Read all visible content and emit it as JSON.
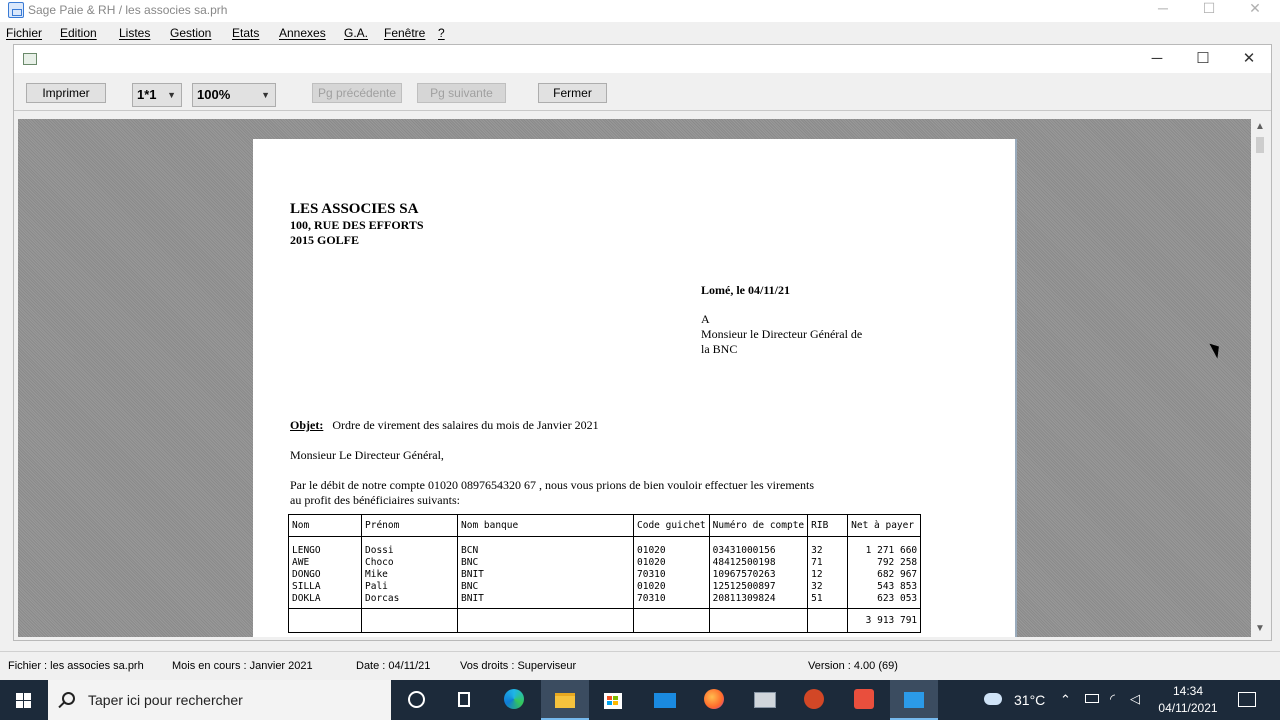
{
  "window": {
    "title": "Sage Paie & RH / les associes sa.prh"
  },
  "menu": [
    "Fichier",
    "Edition",
    "Listes",
    "Gestion",
    "Etats",
    "Annexes",
    "G.A.",
    "Fenêtre",
    "?"
  ],
  "toolbar": {
    "print": "Imprimer",
    "page_layout": "1*1",
    "zoom": "100%",
    "prev_page": "Pg précédente",
    "next_page": "Pg suivante",
    "close": "Fermer"
  },
  "document": {
    "company_name": "LES ASSOCIES SA",
    "address_line1": "100, RUE DES EFFORTS",
    "address_line2": "2015  GOLFE",
    "date_line": "Lomé, le 04/11/21",
    "addressee": [
      "A",
      "Monsieur le Directeur Général de",
      "la BNC"
    ],
    "objet_label": "Objet:",
    "objet_text": "Ordre de virement des salaires du mois de Janvier 2021",
    "salutation": "Monsieur Le Directeur Général,",
    "body_line1": "Par le débit de notre compte 01020 0897654320 67 , nous vous prions de bien vouloir effectuer les virements",
    "body_line2": "au profit des bénéficiaires suivants:",
    "table": {
      "headers": [
        "Nom",
        "Prénom",
        "Nom banque",
        "Code guichet",
        "Numéro de compte",
        "RIB",
        "Net à payer"
      ],
      "rows": [
        [
          "LENGO",
          "Dossi",
          "BCN",
          "01020",
          "03431000156",
          "32",
          "1 271 660"
        ],
        [
          "AWE",
          "Choco",
          "BNC",
          "01020",
          "48412500198",
          "71",
          "792 258"
        ],
        [
          "DONGO",
          "Mike",
          "BNIT",
          "70310",
          "10967570263",
          "12",
          "682 967"
        ],
        [
          "SILLA",
          "Pali",
          "BNC",
          "01020",
          "12512500897",
          "32",
          "543 853"
        ],
        [
          "DOKLA",
          "Dorcas",
          "BNIT",
          "70310",
          "20811309824",
          "51",
          "623 053"
        ]
      ],
      "total": "3 913 791"
    }
  },
  "status": {
    "file": "Fichier : les associes sa.prh",
    "month": "Mois en cours : Janvier 2021",
    "date": "Date : 04/11/21",
    "rights": "Vos droits : Superviseur",
    "version": "Version : 4.00 (69)"
  },
  "taskbar": {
    "search_placeholder": "Taper ici pour rechercher",
    "weather": "31°C",
    "time": "14:34",
    "date": "04/11/2021"
  },
  "colors": {
    "taskbar": "#1c2a3a",
    "accent": "#76b9ed",
    "preview_bg": "#8e8e8e"
  }
}
